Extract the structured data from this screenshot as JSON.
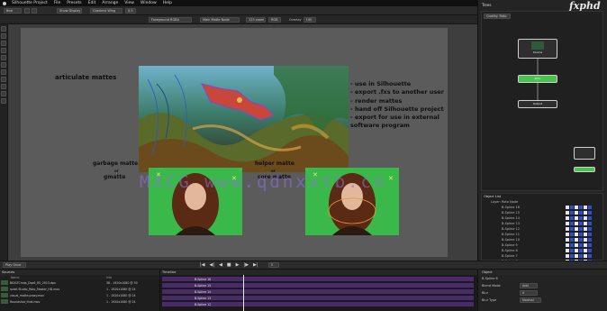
{
  "menubar": {
    "items": [
      "Silhouette Project",
      "File",
      "Presets",
      "Edit",
      "Arrange",
      "View",
      "Window",
      "Help"
    ]
  },
  "toolbar": {
    "node_dropdown": "Bezi",
    "shape_dropdown": "Show Display",
    "mode_dropdown": "Gradient Wing",
    "blend_dropdown": "0.5",
    "viewer_dropdown_1": "Foreground RGBA",
    "viewer_dropdown_2": "Main Matte Node",
    "zoom": "125 zoom",
    "channel": "RGB",
    "overlay_label": "Overlay",
    "overlay_value": "100"
  },
  "slide": {
    "articulate": "articulate mattes",
    "bullets": [
      "- use in Silhouette",
      "- export .fxs to another user",
      "- render mattes",
      "- hand off Silhouette project",
      "- export for use in external",
      "   software program"
    ],
    "garbage_line1": "garbage matte",
    "garbage_or": "or",
    "garbage_line2": "gmatte",
    "helper_line1": "helper matte",
    "helper_or": "or",
    "helper_line2": "core matte",
    "watermark": "MXCG  www.qdnxxtb.cn"
  },
  "brand": {
    "logo": "fxphd"
  },
  "tree": {
    "panel_title": "Trees",
    "tree_dropdown": "Quality: Roto",
    "node_source": "Source",
    "node_roto": "Roto",
    "node_output": "Output"
  },
  "object_list": {
    "title": "Object List",
    "root": "Layer: Roto Node",
    "items": [
      "B-Spline 16",
      "B-Spline 15",
      "B-Spline 14",
      "B-Spline 13",
      "B-Spline 12",
      "B-Spline 11",
      "B-Spline 10",
      "B-Spline 9",
      "B-Spline 8",
      "B-Spline 7",
      "B-Spline 6"
    ]
  },
  "statusbar": {
    "left_dropdown": "Play Once",
    "frame": "3",
    "timeline_label": "Timeline"
  },
  "sources": {
    "title": "Sources",
    "col_name": "Name",
    "col_info": "Info",
    "rows": [
      {
        "name": "BKXLTCmds_Dqc6_R0_2013.dpx",
        "info": "38 - 1920x1080 @ 30"
      },
      {
        "name": "rpdel-Studio_Roto_Master_HD.mov",
        "info": "1 - 1920x1080 @ 24"
      },
      {
        "name": "visual_matte-proxy.mov",
        "info": "1 - 1920x1080 @ 24"
      },
      {
        "name": "Roundshot_final.mov",
        "info": "1 - 1920x1080 @ 24"
      }
    ]
  },
  "timeline": {
    "tracks": [
      "B-Spline 16",
      "B-Spline 15",
      "B-Spline 14",
      "B-Spline 13",
      "B-Spline 12"
    ]
  },
  "object_panel": {
    "title": "Object",
    "shape_name": "B-Spline 6",
    "blend_label": "Blend Mode",
    "blend_value": "Add",
    "blur_label": "Blur",
    "blur_value": "0",
    "blurtype_label": "Blur Type",
    "blurtype_value": "Normal",
    "invert_label": "Invert",
    "colors": {
      "node_accent": "#49c24e",
      "track_purple": "#4a2b6a",
      "green_screen": "#3bb84a"
    }
  }
}
